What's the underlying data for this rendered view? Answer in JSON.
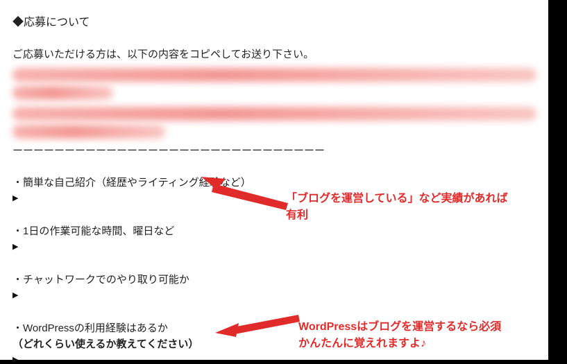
{
  "heading": "◆応募について",
  "intro": "ご応募いただける方は、以下の内容をコピペしてお送り下さい。",
  "divider": "ーーーーーーーーーーーーーーーーーーーーーーーーーーーーーー",
  "items": [
    {
      "label": "・簡単な自己紹介（経歴やライティング経験など）",
      "tri": "▶",
      "extra": ""
    },
    {
      "label": "・1日の作業可能な時間、曜日など",
      "tri": "▶",
      "extra": ""
    },
    {
      "label": "・チャットワークでのやり取り可能か",
      "tri": "▶",
      "extra": ""
    },
    {
      "label": "・WordPressの利用経験はあるか",
      "tri": "▶",
      "extra": "（どれくらい使えるか教えてください）"
    }
  ],
  "annotations": {
    "top": {
      "line1": "「ブログを運営している」など実績があれば",
      "line2": "有利"
    },
    "bottom": {
      "line1": "WordPressはブログを運営するなら必須",
      "line2": "かんたんに覚えれますよ♪"
    }
  }
}
